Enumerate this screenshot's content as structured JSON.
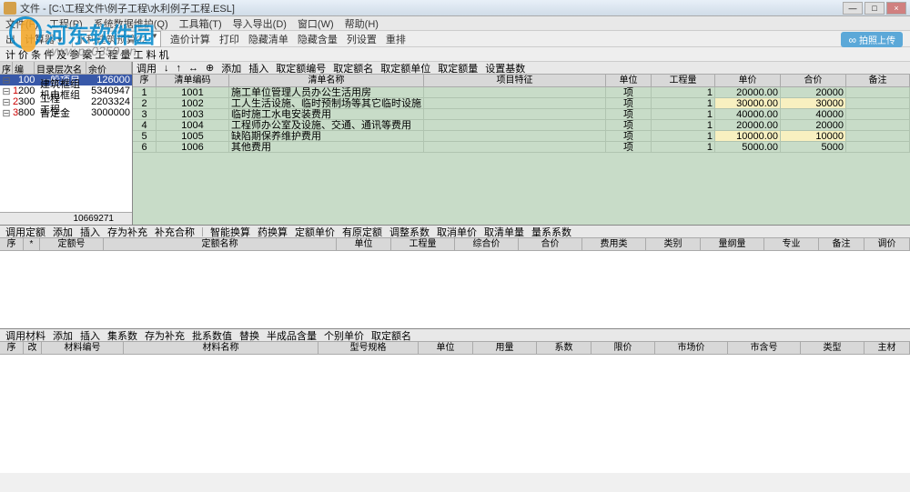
{
  "window": {
    "title": "文件 - [C:\\工程文件\\例子工程\\水利例子工程.ESL]",
    "min": "—",
    "max": "□",
    "close": "×"
  },
  "menu": [
    "文件(F)",
    "工程(P)",
    "系统数据维护(Q)",
    "工具箱(T)",
    "导入导出(D)",
    "窗口(W)",
    "帮助(H)"
  ],
  "tb1": {
    "items": [
      "出",
      "计算器 ▾"
    ],
    "dropdown": "水利建筑预算02",
    "rest": [
      "造价计算",
      "打印",
      "隐藏清单",
      "隐藏含量",
      "列设置",
      "重排"
    ],
    "upload": "拍照上传"
  },
  "tb2": "计 价 条 件 及 参 案      工    程    量    工    料    机",
  "left": {
    "head": [
      "序",
      "编码",
      "目录层次名称",
      "余价"
    ],
    "rows": [
      {
        "i": "",
        "c": "100",
        "n": "一般项目",
        "a": "126000",
        "sel": true
      },
      {
        "i": "1",
        "c": "200",
        "n": "建筑框组工程",
        "a": "5340947"
      },
      {
        "i": "2",
        "c": "300",
        "n": "机电框组工程",
        "a": "2203324"
      },
      {
        "i": "3",
        "c": "800",
        "n": "暂定金",
        "a": "3000000"
      }
    ],
    "total": "10669271"
  },
  "right": {
    "toolbar": [
      "调用",
      "↓",
      "↑",
      "↔",
      "⊕",
      "添加",
      "插入",
      "取定额编号",
      "取定额名",
      "取定额单位",
      "取定额量",
      "设置基数"
    ],
    "head": [
      "序",
      "清单编码",
      "清单名称",
      "项目特征",
      "单位",
      "工程量",
      "单价",
      "合价",
      "备注"
    ],
    "rows": [
      {
        "xu": "1",
        "code": "1001",
        "name": "施工单位管理人员办公生活用房",
        "unit": "项",
        "qty": "1",
        "price": "20000.00",
        "total": "20000",
        "y": false
      },
      {
        "xu": "2",
        "code": "1002",
        "name": "工人生活设施、临时预制场等其它临时设施",
        "unit": "项",
        "qty": "1",
        "price": "30000.00",
        "total": "30000",
        "y": true
      },
      {
        "xu": "3",
        "code": "1003",
        "name": "临时施工水电安装费用",
        "unit": "项",
        "qty": "1",
        "price": "40000.00",
        "total": "40000",
        "y": false
      },
      {
        "xu": "4",
        "code": "1004",
        "name": "工程师办公室及设施、交通、通讯等费用",
        "unit": "项",
        "qty": "1",
        "price": "20000.00",
        "total": "20000",
        "y": false
      },
      {
        "xu": "5",
        "code": "1005",
        "name": "缺陷期保养维护费用",
        "unit": "项",
        "qty": "1",
        "price": "10000.00",
        "total": "10000",
        "y": true
      },
      {
        "xu": "6",
        "code": "1006",
        "name": "其他费用",
        "unit": "项",
        "qty": "1",
        "price": "5000.00",
        "total": "5000",
        "y": false
      }
    ]
  },
  "mid": {
    "tb_left": [
      "调用定额",
      "添加",
      "插入",
      "存为补充",
      "补充合称"
    ],
    "tb_right": [
      "智能换算",
      "药换算",
      "定额单价",
      "有原定额",
      "调整系数",
      "取消单价",
      "取清单量",
      "量系系数"
    ],
    "head": [
      "序",
      "*",
      "定额号",
      "定额名称",
      "单位",
      "工程量",
      "综合价",
      "合价",
      "费用类",
      "类别",
      "量纲量",
      "专业",
      "备注",
      "调价"
    ]
  },
  "bot": {
    "tb": [
      "调用材料",
      "添加",
      "插入",
      "集系数",
      "存为补充",
      "批系数值",
      "替换",
      "半成品含量",
      "个别单价",
      "取定额名"
    ],
    "head": [
      "序",
      "改",
      "材料编号",
      "材料名称",
      "型号规格",
      "单位",
      "用量",
      "系数",
      "限价",
      "市场价",
      "市含号",
      "类型",
      "主材"
    ]
  },
  "watermark": {
    "name": "河东软件园",
    "url": "www.pc0359.cn"
  }
}
